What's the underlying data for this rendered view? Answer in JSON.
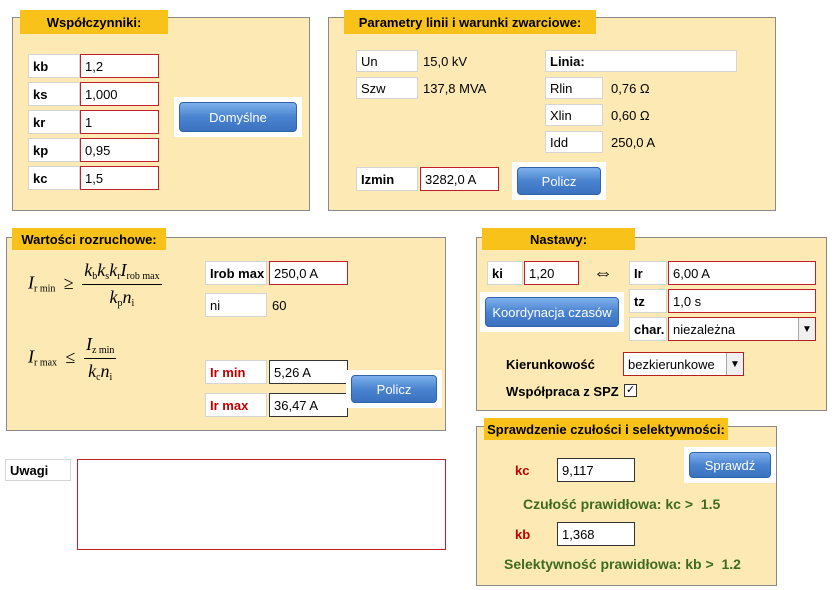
{
  "coeffs": {
    "title": "Współczynniki:",
    "rows": [
      {
        "label": "kb",
        "value": "1,2"
      },
      {
        "label": "ks",
        "value": "1,000"
      },
      {
        "label": "kr",
        "value": "1"
      },
      {
        "label": "kp",
        "value": "0,95"
      },
      {
        "label": "kc",
        "value": "1,5"
      }
    ],
    "default_button": "Domyślne"
  },
  "line": {
    "title": "Parametry linii i warunki zwarciowe:",
    "un_label": "Un",
    "un_value": "15,0 kV",
    "szw_label": "Szw",
    "szw_value": "137,8 MVA",
    "linia_label": "Linia:",
    "rlin_label": "Rlin",
    "rlin_value": "0,76 Ω",
    "xlin_label": "Xlin",
    "xlin_value": "0,60 Ω",
    "idd_label": "Idd",
    "idd_value": "250,0 A",
    "izmin_label": "Izmin",
    "izmin_value": "3282,0 A",
    "calc_button": "Policz"
  },
  "start": {
    "title": "Wartości rozruchowe:",
    "formula1": {
      "lhs": "I",
      "lhs_sub": "r min",
      "rel": "≥",
      "num": [
        "k",
        "b",
        "k",
        "s",
        "k",
        "r",
        "I",
        "rob max"
      ],
      "den": [
        "k",
        "p",
        "n",
        "i"
      ]
    },
    "formula2": {
      "lhs": "I",
      "lhs_sub": "r max",
      "rel": "≤",
      "num": [
        "I",
        "z min"
      ],
      "den": [
        "k",
        "c",
        "n",
        "i"
      ]
    },
    "irob_label": "Irob max",
    "irob_value": "250,0 A",
    "ni_label": "ni",
    "ni_value": "60",
    "irmin_label": "Ir min",
    "irmin_value": "5,26 A",
    "irmax_label": "Ir max",
    "irmax_value": "36,47 A",
    "calc_button": "Policz"
  },
  "settings": {
    "title": "Nastawy:",
    "ki_label": "ki",
    "ki_value": "1,20",
    "link_icon": "⇔",
    "ir_label": "Ir",
    "ir_value": "6,00 A",
    "tz_label": "tz",
    "tz_value": "1,0 s",
    "char_label": "char.",
    "char_value": "niezależna",
    "coord_button": "Koordynacja czasów",
    "dir_label": "Kierunkowość",
    "dir_value": "bezkierunkowe",
    "spz_label": "Współpraca z SPZ",
    "spz_checked": "✓"
  },
  "check": {
    "title": "Sprawdzenie czułości i selektywności:",
    "kc_label": "kc",
    "kc_value": "9,117",
    "kb_label": "kb",
    "kb_value": "1,368",
    "check_button": "Sprawdź",
    "sens_text": "Czułość prawidłowa: kc >",
    "sens_value": "1.5",
    "sel_text": "Selektywność prawidłowa: kb >",
    "sel_value": "1.2"
  },
  "notes": {
    "label": "Uwagi",
    "value": ""
  }
}
